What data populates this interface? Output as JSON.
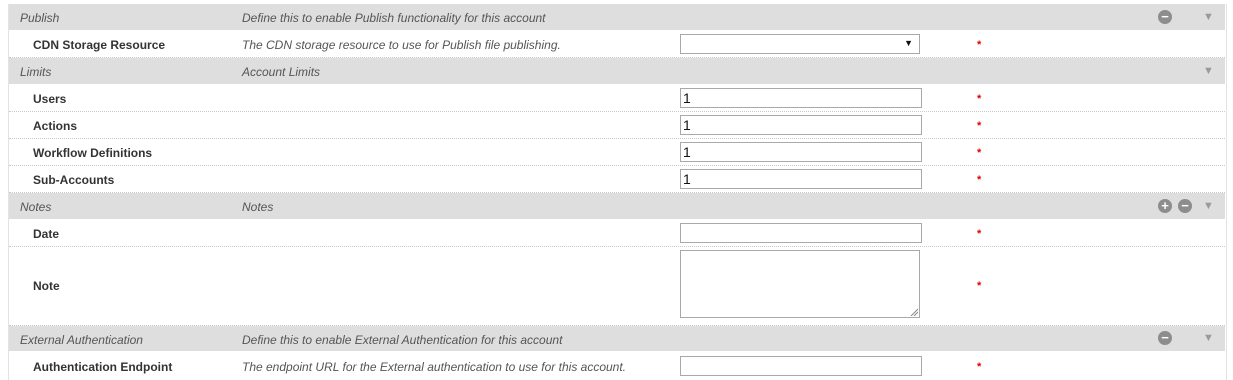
{
  "sections": {
    "publish": {
      "title": "Publish",
      "description": "Define this to enable Publish functionality for this account",
      "fields": {
        "cdn": {
          "label": "CDN Storage Resource",
          "description": "The CDN storage resource to use for Publish file publishing.",
          "value": "",
          "required_marker": "*"
        }
      }
    },
    "limits": {
      "title": "Limits",
      "description": "Account Limits",
      "fields": {
        "users": {
          "label": "Users",
          "value": "1",
          "required_marker": "*"
        },
        "actions": {
          "label": "Actions",
          "value": "1",
          "required_marker": "*"
        },
        "workflow_definitions": {
          "label": "Workflow Definitions",
          "value": "1",
          "required_marker": "*"
        },
        "sub_accounts": {
          "label": "Sub-Accounts",
          "value": "1",
          "required_marker": "*"
        }
      }
    },
    "notes": {
      "title": "Notes",
      "description": "Notes",
      "fields": {
        "date": {
          "label": "Date",
          "value": "",
          "required_marker": "*"
        },
        "note": {
          "label": "Note",
          "value": "",
          "required_marker": "*"
        }
      }
    },
    "external_auth": {
      "title": "External Authentication",
      "description": "Define this to enable External Authentication for this account",
      "fields": {
        "endpoint": {
          "label": "Authentication Endpoint",
          "description": "The endpoint URL for the External authentication to use for this account.",
          "value": "",
          "required_marker": "*"
        }
      }
    }
  },
  "icons": {
    "plus": "plus-circle-icon",
    "minus": "minus-circle-icon",
    "collapse": "chevron-down-icon"
  },
  "colors": {
    "section_background": "#dedede",
    "required_marker": "#e00000",
    "icon_gray": "#8d8d8d"
  }
}
